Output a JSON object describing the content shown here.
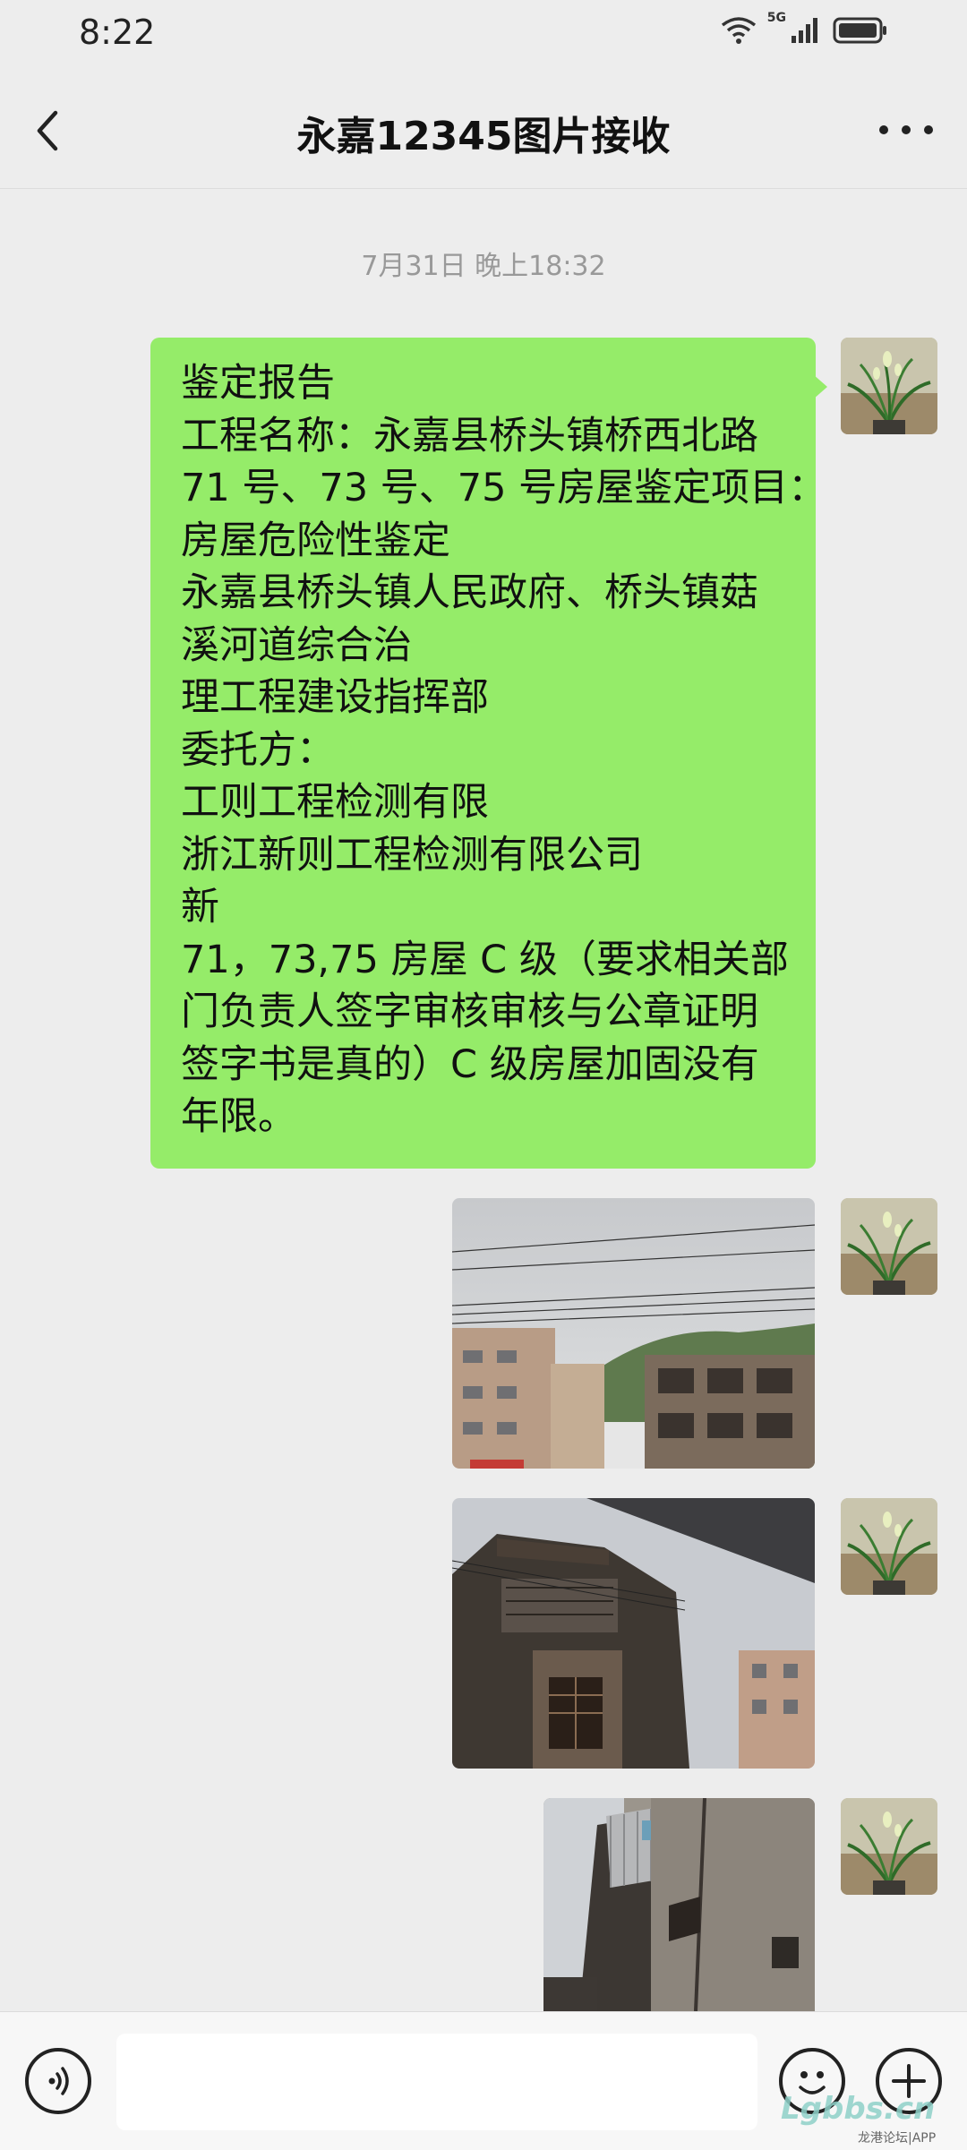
{
  "status_bar": {
    "time": "8:22",
    "signal_label": "5G"
  },
  "header": {
    "title": "永嘉12345图片接收"
  },
  "messages": {
    "timestamp": "7月31日 晚上18:32",
    "text_lines": [
      "鉴定报告",
      "工程名称：永嘉县桥头镇桥西北路",
      "71 号、73 号、75 号房屋鉴定项目：",
      "房屋危险性鉴定",
      "永嘉县桥头镇人民政府、桥头镇菇",
      "溪河道综合治",
      "理工程建设指挥部",
      "委托方：",
      "工则工程检测有限",
      "浙江新则工程检测有限公司",
      "新",
      "71，73,75 房屋 C 级（要求相关部",
      "门负责人签字审核审核与公章证明",
      "签字书是真的）C 级房屋加固没有",
      "年限。"
    ]
  },
  "watermark": {
    "logo": "Lgbbs.cn",
    "sub": "龙港论坛|APP"
  },
  "icons": {
    "back": "back-arrow-icon",
    "more": "more-icon",
    "voice": "voice-icon",
    "emoji": "emoji-icon",
    "plus": "plus-icon"
  },
  "colors": {
    "bubble": "#95ec69",
    "background": "#ededed"
  }
}
